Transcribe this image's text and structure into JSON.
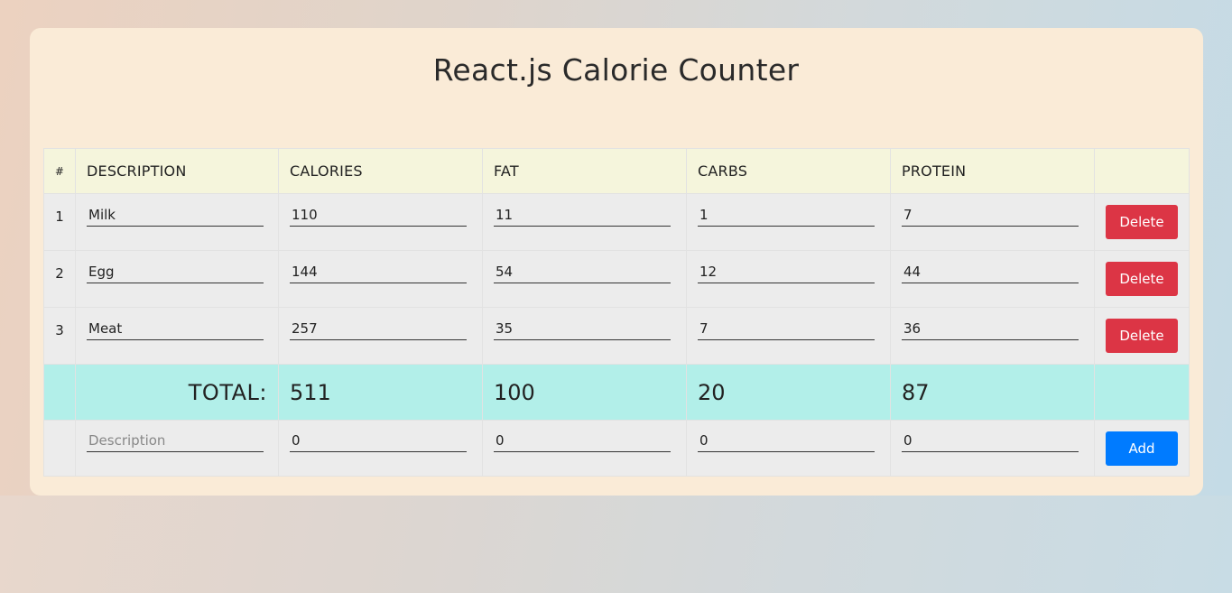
{
  "title": "React.js Calorie Counter",
  "headers": [
    "#",
    "DESCRIPTION",
    "CALORIES",
    "FAT",
    "CARBS",
    "PROTEIN"
  ],
  "items": [
    {
      "index": "1",
      "description": "Milk",
      "calories": "110",
      "fat": "11",
      "carbs": "1",
      "protein": "7",
      "delete_label": "Delete"
    },
    {
      "index": "2",
      "description": "Egg",
      "calories": "144",
      "fat": "54",
      "carbs": "12",
      "protein": "44",
      "delete_label": "Delete"
    },
    {
      "index": "3",
      "description": "Meat",
      "calories": "257",
      "fat": "35",
      "carbs": "7",
      "protein": "36",
      "delete_label": "Delete"
    }
  ],
  "totals": {
    "label": "TOTAL:",
    "calories": "511",
    "fat": "100",
    "carbs": "20",
    "protein": "87"
  },
  "new_item": {
    "description_placeholder": "Description",
    "calories": "0",
    "fat": "0",
    "carbs": "0",
    "protein": "0",
    "add_label": "Add"
  },
  "colors": {
    "delete": "#dc3545",
    "add": "#007bff",
    "total_row": "#b2efe9",
    "header_row": "#f5f5dc",
    "card": "#faebd7"
  }
}
